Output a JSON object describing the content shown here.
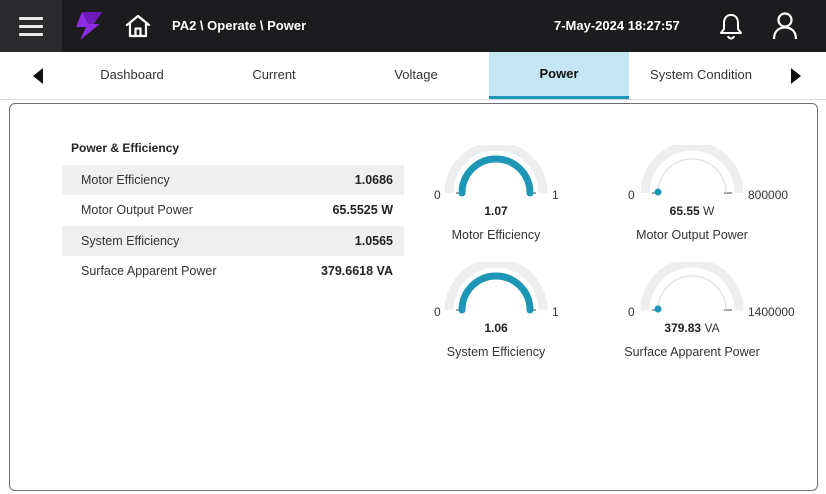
{
  "header": {
    "breadcrumb": "PA2 \\ Operate \\ Power",
    "datetime": "7-May-2024 18:27:57",
    "icons": [
      "menu-icon",
      "app-logo",
      "home-icon",
      "bell-icon",
      "user-icon"
    ],
    "colors": {
      "bar": "#1c1c1e",
      "logo": "#8a2be2"
    }
  },
  "tabs": [
    {
      "label": "Dashboard",
      "active": false
    },
    {
      "label": "Current",
      "active": false
    },
    {
      "label": "Voltage",
      "active": false
    },
    {
      "label": "Power",
      "active": true
    },
    {
      "label": "System Condition",
      "active": false
    }
  ],
  "section": {
    "title": "Power & Efficiency",
    "rows": [
      {
        "label": "Motor Efficiency",
        "value": "1.0686"
      },
      {
        "label": "Motor Output Power",
        "value": "65.5525 W"
      },
      {
        "label": "System Efficiency",
        "value": "1.0565"
      },
      {
        "label": "Surface Apparent Power",
        "value": "379.6618 VA"
      }
    ]
  },
  "gauges": [
    {
      "title": "Motor Efficiency",
      "min": "0",
      "max": "1",
      "value": "1.07",
      "unit": "",
      "fraction": 1.0
    },
    {
      "title": "Motor Output Power",
      "min": "0",
      "max": "800000",
      "value": "65.55",
      "unit": "W",
      "fraction": 0.0
    },
    {
      "title": "System Efficiency",
      "min": "0",
      "max": "1",
      "value": "1.06",
      "unit": "",
      "fraction": 1.0
    },
    {
      "title": "Surface Apparent Power",
      "min": "0",
      "max": "1400000",
      "value": "379.83",
      "unit": "VA",
      "fraction": 0.0
    }
  ],
  "accent": "#1d97b5"
}
